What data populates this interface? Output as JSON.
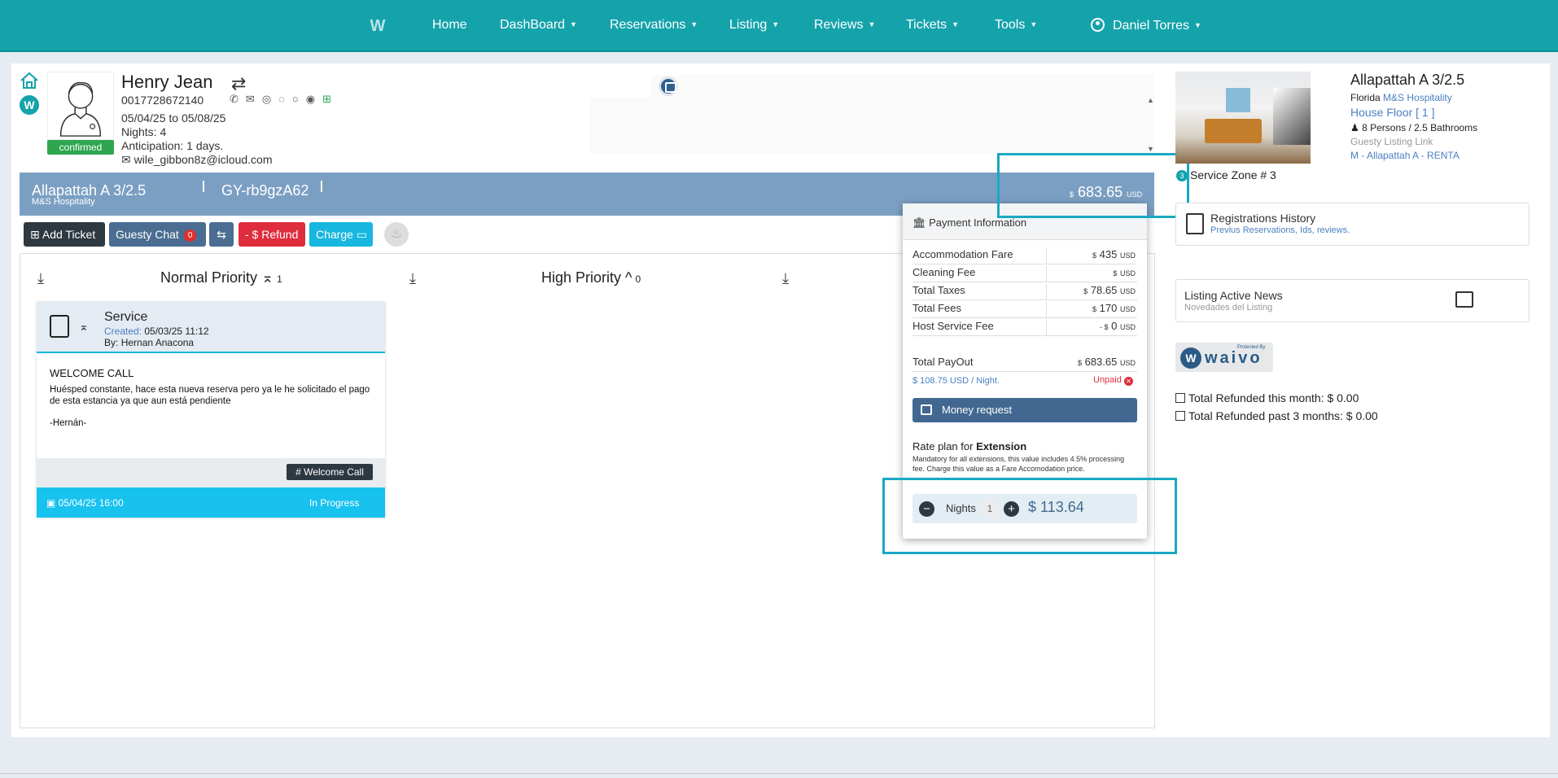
{
  "nav": {
    "items": [
      {
        "label": "Home"
      },
      {
        "label": "DashBoard"
      },
      {
        "label": "Reservations"
      },
      {
        "label": "Listing"
      },
      {
        "label": "Reviews"
      },
      {
        "label": "Tickets"
      },
      {
        "label": "Tools"
      }
    ],
    "user": "Daniel Torres"
  },
  "guest": {
    "name": "Henry Jean",
    "phone": "0017728672140",
    "dates": "05/04/25 to 05/08/25",
    "nights": "Nights: 4",
    "anticipation": "Anticipation: 1 days.",
    "email": "wile_gibbon8z@icloud.com",
    "status": "confirmed"
  },
  "banner": {
    "listing": "Allapattah A 3/2.5",
    "company": "M&S Hospitality",
    "code": "GY-rb9gzA62",
    "currency_symbol": "$",
    "total": "683.65",
    "currency": "USD"
  },
  "toolbar": {
    "add_ticket": "Add Ticket",
    "guesty_chat": "Guesty Chat",
    "chat_count": "0",
    "refund": "- $ Refund",
    "charge": "Charge"
  },
  "priorities": {
    "normal": {
      "label": "Normal Priority",
      "count": "1"
    },
    "high": {
      "label": "High Priority",
      "count": "0"
    }
  },
  "ticket": {
    "type": "Service",
    "created_label": "Created:",
    "created": "05/03/25 11:12",
    "by_label": "By:",
    "by": "Hernan Anacona",
    "title": "WELCOME CALL",
    "description": "Huésped constante, hace esta nueva reserva pero ya le he solicitado el pago de esta estancia ya que aun está pendiente",
    "signature": "-Hernán-",
    "tag": "Welcome Call",
    "due": "05/04/25 16:00",
    "status": "In Progress"
  },
  "payment": {
    "title": "Payment Information",
    "rows": [
      {
        "label": "Accommodation Fare",
        "sym": "$",
        "value": "435",
        "cur": "USD"
      },
      {
        "label": "Cleaning Fee",
        "sym": "$",
        "value": "",
        "cur": "USD"
      },
      {
        "label": "Total Taxes",
        "sym": "$",
        "value": "78.65",
        "cur": "USD"
      },
      {
        "label": "Total Fees",
        "sym": "$",
        "value": "170",
        "cur": "USD"
      },
      {
        "label": "Host Service Fee",
        "sym": "- $",
        "value": "0",
        "cur": "USD"
      }
    ],
    "payout_label": "Total PayOut",
    "payout_sym": "$",
    "payout_value": "683.65",
    "payout_cur": "USD",
    "per_night": "$ 108.75 USD / Night.",
    "paid_status": "Unpaid",
    "money_request": "Money request",
    "rate_plan_prefix": "Rate plan for",
    "rate_plan_name": "Extension",
    "rate_plan_desc": "Mandatory for all extensions, this value includes 4.5% processing fee. Charge this value as a Fare Accomodation price.",
    "nights_label": "Nights",
    "nights_value": "1",
    "extension_price": "$ 113.64"
  },
  "listing": {
    "name": "Allapattah A 3/2.5",
    "state": "Florida",
    "company": "M&S Hospitality",
    "floor": "House Floor [ 1 ]",
    "capacity": "8 Persons / 2.5 Bathrooms",
    "link_label": "Guesty Listing Link",
    "code": "M - Allapattah A - RENTA",
    "zone_num": "3",
    "zone": "Service Zone # 3"
  },
  "registrations": {
    "title": "Registrations History",
    "subtitle": "Previus Reservations, Ids, reviews."
  },
  "news": {
    "title": "Listing Active News",
    "subtitle": "Novedades del Listing"
  },
  "waivo": {
    "brand": "waivo",
    "protected": "Protected By"
  },
  "refunds": {
    "month_label": "Total Refunded this month:",
    "month_value": "$ 0.00",
    "three_label": "Total Refunded past 3 months:",
    "three_value": "$ 0.00"
  },
  "colors": {
    "brand": "#14a3ab",
    "banner": "#7b9fc2",
    "accent_blue": "#426891",
    "danger": "#e02d3e",
    "success": "#2ea64f",
    "info": "#18c2ef"
  }
}
